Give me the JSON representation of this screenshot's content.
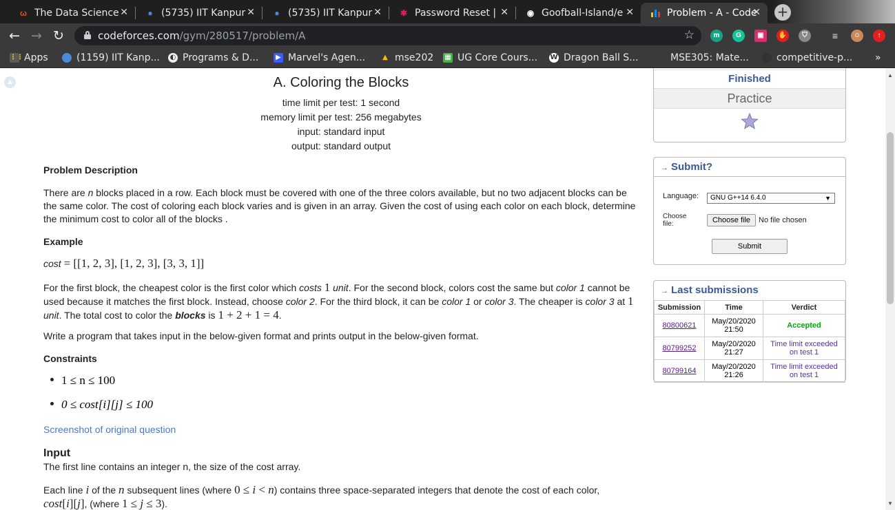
{
  "browser": {
    "tabs": [
      {
        "title": "The Data Science",
        "icon": "data-science-icon",
        "color": "#e34c26"
      },
      {
        "title": "(5735) IIT Kanpur",
        "icon": "iitk-icon",
        "color": "#4a8ad6"
      },
      {
        "title": "(5735) IIT Kanpur",
        "icon": "iitk-icon",
        "color": "#4a8ad6"
      },
      {
        "title": "Password Reset |",
        "icon": "slack-icon",
        "color": "#e01e5a"
      },
      {
        "title": "Goofball-Island/e",
        "icon": "github-icon",
        "color": "#ffffff"
      },
      {
        "title": "Problem - A - Code",
        "icon": "codeforces-icon",
        "color": "#f5c518",
        "active": true
      }
    ],
    "url_domain": "codeforces.com",
    "url_path": "/gym/280517/problem/A",
    "bookmarks": [
      {
        "label": "Apps"
      },
      {
        "label": "(1159) IIT Kanp..."
      },
      {
        "label": "Programs & D..."
      },
      {
        "label": "Marvel's Agen..."
      },
      {
        "label": "mse202"
      },
      {
        "label": "UG Core Cours..."
      },
      {
        "label": "Dragon Ball S..."
      },
      {
        "label": "MSE305: Mate..."
      },
      {
        "label": "competitive-p..."
      }
    ],
    "bookmarks_more": "»"
  },
  "problem": {
    "title": "A. Coloring the Blocks",
    "time_limit": "time limit per test: 1 second",
    "memory_limit": "memory limit per test: 256 megabytes",
    "input": "input: standard input",
    "output": "output: standard output",
    "desc_heading": "Problem Description",
    "desc_p1": "blocks placed in a row. Each block must be covered with one of the three colors available, but no two adjacent blocks can be the same color. The cost of coloring each block varies and is given in an array. Given the cost of using each color on each block, determine the minimum cost to color all of the blocks .",
    "example_heading": "Example",
    "example_formula": "[[1, 2, 3], [1, 2, 3], [3, 3, 1]]",
    "write_program": "Write a program that takes input in the below-given format and prints output in the below-given format.",
    "constraints_heading": "Constraints",
    "constraint1": "1 ≤ n ≤ 100",
    "constraint2": "0 ≤ cost[i][j] ≤ 100",
    "screenshot_link": "Screenshot of original question",
    "input_heading": "Input",
    "input_line1": "The first line contains an integer n, the size of the cost array.",
    "input_line2b": "subsequent lines (where",
    "input_line2c": ") contains three space-separated integers that denote the cost of each color,"
  },
  "sidebar": {
    "contest_status": "Finished",
    "contest_mode": "Practice",
    "submit_header": "Submit?",
    "language_label": "Language:",
    "language_value": "GNU G++14 6.4.0",
    "choose_file_label": "Choose file:",
    "choose_file_button": "Choose file",
    "no_file": "No file chosen",
    "submit_button": "Submit",
    "last_submissions_header": "Last submissions",
    "columns": [
      "Submission",
      "Time",
      "Verdict"
    ],
    "submissions": [
      {
        "id": "80800621",
        "date": "May/20/2020",
        "time": "21:50",
        "verdict": "Accepted",
        "verdict2": ""
      },
      {
        "id": "80799252",
        "date": "May/20/2020",
        "time": "21:27",
        "verdict": "Time limit exceeded",
        "verdict2": "on test 1"
      },
      {
        "id": "80799164",
        "date": "May/20/2020",
        "time": "21:26",
        "verdict": "Time limit exceeded",
        "verdict2": "on test 1"
      }
    ]
  }
}
